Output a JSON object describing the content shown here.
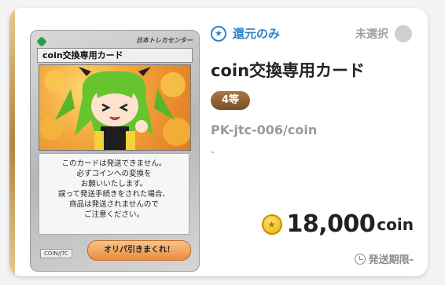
{
  "card": {
    "brand": "日本トレカセンター",
    "title": "coin交換専用カード",
    "notice_lines": [
      "このカードは発送できません。",
      "必ずコインへの変換を",
      "お願いいたします。",
      "誤って発送手続きをされた場合、",
      "商品は発送されませんので",
      "ご注意ください。"
    ],
    "id_tag": "COIN/JTC",
    "button_label": "オリパ引きまくれ！"
  },
  "coupon": {
    "icon": "star-icon",
    "label": "還元のみ"
  },
  "selection": {
    "label": "未選択"
  },
  "product": {
    "title": "coin交換専用カード",
    "grade": "4等",
    "code": "PK-jtc-006/coin",
    "note": "-"
  },
  "price": {
    "icon": "coin-star-icon",
    "value": "18,000",
    "unit": "coin"
  },
  "shipping": {
    "icon": "clock-icon",
    "label": "発送期限-"
  },
  "colors": {
    "accent_blue": "#2f84c9",
    "grade_brown": "#8b5a2b",
    "coin_gold": "#e8b20f"
  }
}
